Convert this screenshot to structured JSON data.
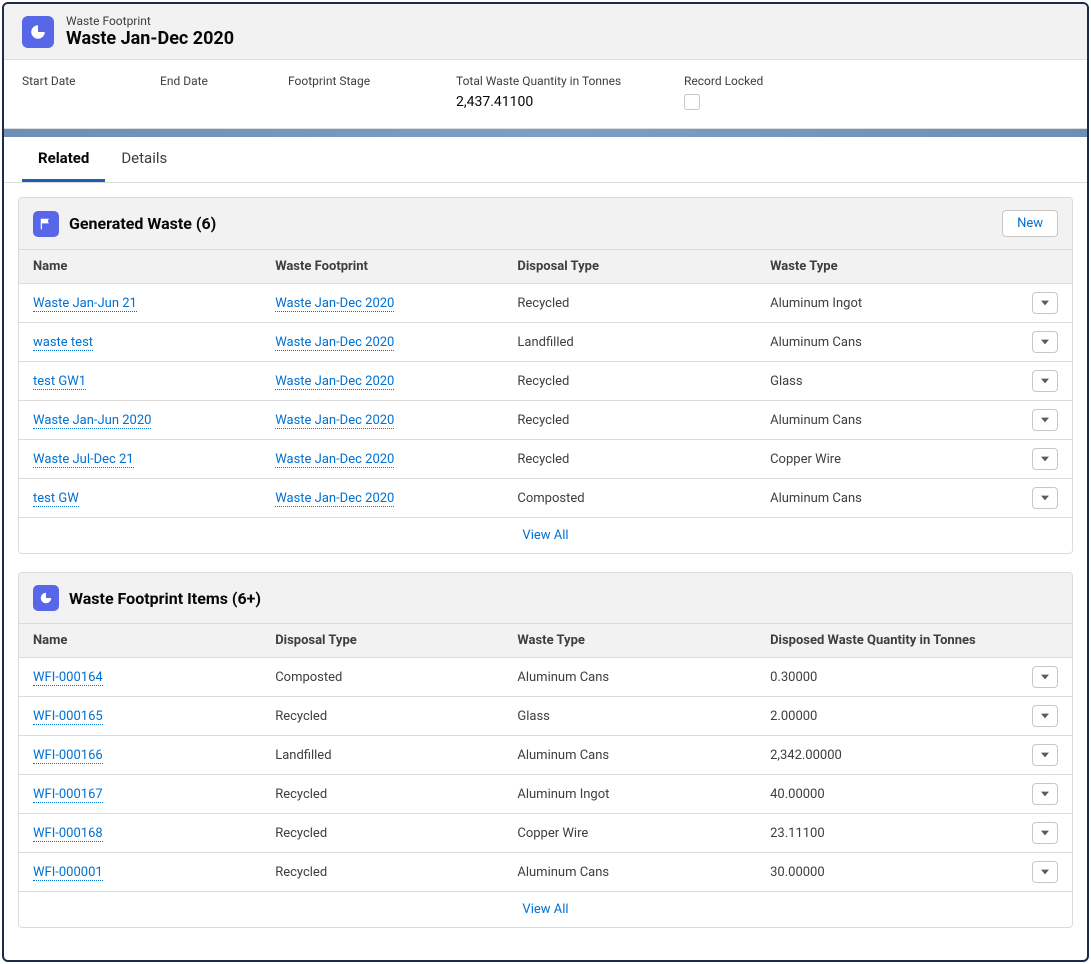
{
  "header": {
    "objectLabel": "Waste Footprint",
    "title": "Waste Jan-Dec 2020"
  },
  "summary": {
    "startDateLabel": "Start Date",
    "startDate": "",
    "endDateLabel": "End Date",
    "endDate": "",
    "stageLabel": "Footprint Stage",
    "stage": "",
    "qtyLabel": "Total Waste Quantity in Tonnes",
    "qty": "2,437.41100",
    "lockedLabel": "Record Locked"
  },
  "tabs": {
    "related": "Related",
    "details": "Details"
  },
  "generated": {
    "title": "Generated Waste (6)",
    "newLabel": "New",
    "viewAll": "View All",
    "cols": {
      "name": "Name",
      "footprint": "Waste Footprint",
      "disposal": "Disposal Type",
      "waste": "Waste Type"
    },
    "rows": [
      {
        "name": "Waste Jan-Jun 21",
        "footprint": "Waste Jan-Dec 2020",
        "disposal": "Recycled",
        "waste": "Aluminum Ingot"
      },
      {
        "name": "waste test",
        "footprint": "Waste Jan-Dec 2020",
        "disposal": "Landfilled",
        "waste": "Aluminum Cans"
      },
      {
        "name": "test GW1",
        "footprint": "Waste Jan-Dec 2020",
        "disposal": "Recycled",
        "waste": "Glass"
      },
      {
        "name": "Waste Jan-Jun 2020",
        "footprint": "Waste Jan-Dec 2020",
        "disposal": "Recycled",
        "waste": "Aluminum Cans"
      },
      {
        "name": "Waste Jul-Dec 21",
        "footprint": "Waste Jan-Dec 2020",
        "disposal": "Recycled",
        "waste": "Copper Wire"
      },
      {
        "name": "test GW",
        "footprint": "Waste Jan-Dec 2020",
        "disposal": "Composted",
        "waste": "Aluminum Cans"
      }
    ]
  },
  "items": {
    "title": "Waste Footprint Items (6+)",
    "viewAll": "View All",
    "cols": {
      "name": "Name",
      "disposal": "Disposal Type",
      "waste": "Waste Type",
      "qty": "Disposed Waste Quantity in Tonnes"
    },
    "rows": [
      {
        "name": "WFI-000164",
        "disposal": "Composted",
        "waste": "Aluminum Cans",
        "qty": "0.30000"
      },
      {
        "name": "WFI-000165",
        "disposal": "Recycled",
        "waste": "Glass",
        "qty": "2.00000"
      },
      {
        "name": "WFI-000166",
        "disposal": "Landfilled",
        "waste": "Aluminum Cans",
        "qty": "2,342.00000"
      },
      {
        "name": "WFI-000167",
        "disposal": "Recycled",
        "waste": "Aluminum Ingot",
        "qty": "40.00000"
      },
      {
        "name": "WFI-000168",
        "disposal": "Recycled",
        "waste": "Copper Wire",
        "qty": "23.11100"
      },
      {
        "name": "WFI-000001",
        "disposal": "Recycled",
        "waste": "Aluminum Cans",
        "qty": "30.00000"
      }
    ]
  }
}
